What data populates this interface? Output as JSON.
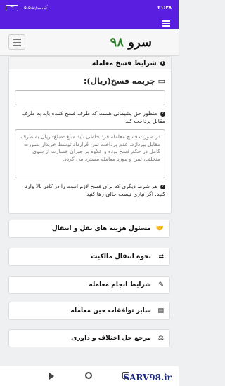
{
  "status_bar": {
    "time": "۲۱:۲۸",
    "battery": "۳۷",
    "left_text": "۵.۵ک.ب/ث"
  },
  "brand": {
    "name": "سرو",
    "number": "۹۸"
  },
  "section": {
    "title": "شرایط فسخ معامله",
    "penalty_label": "جریمه فسخ(ریال):",
    "penalty_value": "",
    "help1": "منظور حق پشیمانی هست که طرف فسخ کننده باید به طرف مقابل پرداخت کند",
    "textarea_placeholder": "در صورت فسخ معامله فرد خاطی باید مبلغ -مبلغ- ریال به طرف مقابل بپردازد. عدم پرداخت ثمن قرارداد توسط خریدار بصورت کامل در حکم فسخ بوده و علاوه بر جبران خسارت از سوی متخلف، ثمن و مورد معامله مسترد می گردد.",
    "help2": "هر شرط دیگری که برای فسخ لازم است را در کادر بالا وارد کنید. اگر نیازی نیست خالی رها کنید"
  },
  "menu_items": [
    {
      "label": "مسئول هزینه های نقل و انتقال",
      "icon": "handshake-icon",
      "glyph": "🤝"
    },
    {
      "label": "نحوه انتقال مالکیت",
      "icon": "transfer-icon",
      "glyph": "⇄"
    },
    {
      "label": "شرایط انجام معامله",
      "icon": "edit-icon",
      "glyph": "✎"
    },
    {
      "label": "سایر توافقات حین معامله",
      "icon": "document-icon",
      "glyph": "▤"
    },
    {
      "label": "مرجع حل اختلاف و داوری",
      "icon": "scale-icon",
      "glyph": "⚖"
    }
  ],
  "watermark": "SARV98.ir"
}
